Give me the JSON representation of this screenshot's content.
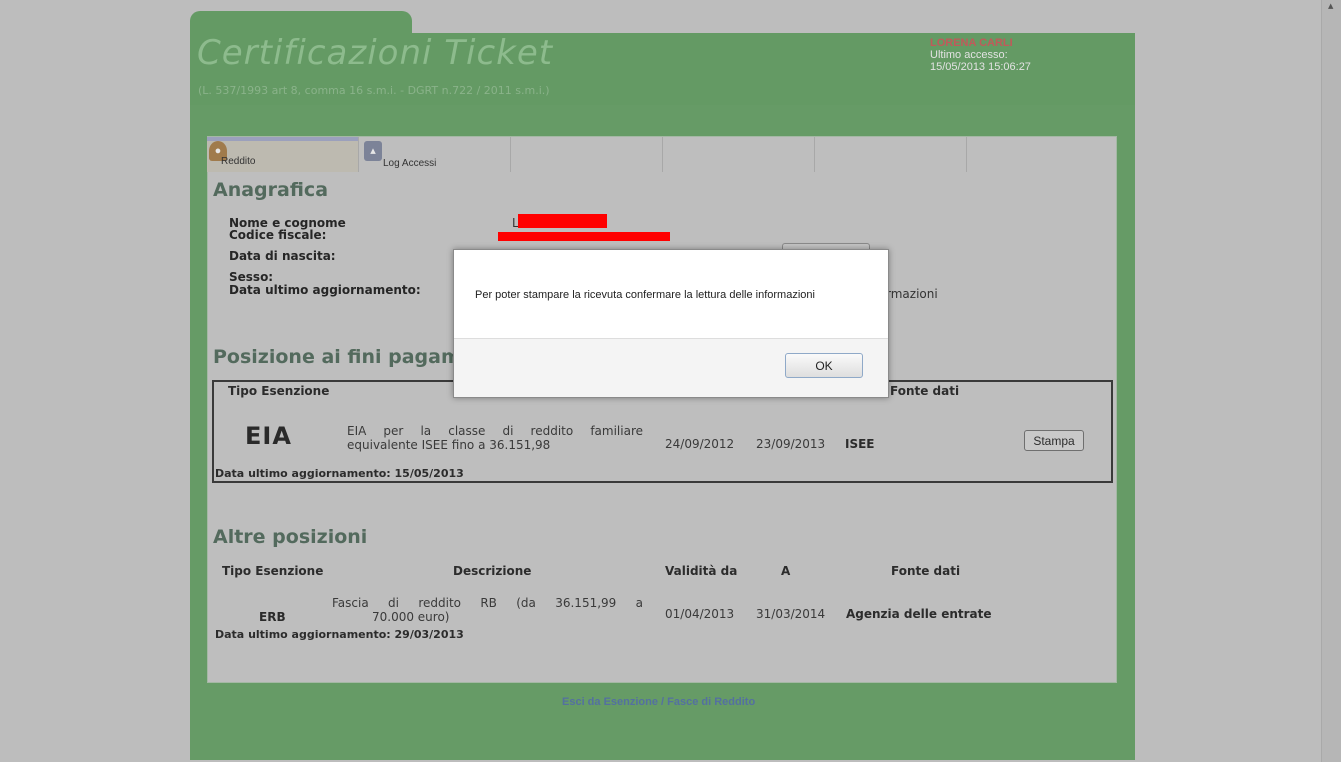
{
  "header": {
    "title": "Certificazioni Ticket",
    "subtitle": "(L. 537/1993 art 8, comma 16 s.m.i. - DGRT n.722 / 2011 s.m.i.)",
    "user_name": "LORENA CARLI",
    "last_access_label": "Ultimo accesso:",
    "last_access_value": "15/05/2013 15:06:27"
  },
  "tabs": [
    {
      "label": "Reddito",
      "icon": "user-icon"
    },
    {
      "label": "Log Accessi",
      "icon": "log-icon"
    }
  ],
  "anagrafica": {
    "title": "Anagrafica",
    "fields": [
      {
        "label": "Nome e cognome",
        "value": "L"
      },
      {
        "label": "Codice fiscale:"
      },
      {
        "label": "Data di nascita:"
      },
      {
        "label": "Sesso:"
      },
      {
        "label": "Data ultimo aggiornamento:",
        "value": "rmazioni"
      }
    ]
  },
  "posizione": {
    "title": "Posizione ai fini pagam",
    "col_tipo": "Tipo Esenzione",
    "col_fonte": "Fonte dati",
    "row": {
      "code": "EIA",
      "description_line1": "EIA per la classe di reddito familiare",
      "description_line2": "equivalente ISEE fino a 36.151,98",
      "from": "24/09/2012",
      "to": "23/09/2013",
      "source": "ISEE",
      "print_label": "Stampa"
    },
    "updated": "Data ultimo aggiornamento: 15/05/2013"
  },
  "altre": {
    "title": "Altre posizioni",
    "headers": {
      "tipo": "Tipo Esenzione",
      "descrizione": "Descrizione",
      "validita": "Validità da",
      "a": "A",
      "fonte": "Fonte dati"
    },
    "row": {
      "code": "ERB",
      "description_line1": "Fascia di reddito RB (da 36.151,99 a",
      "description_line2": "70.000 euro)",
      "from": "01/04/2013",
      "to": "31/03/2014",
      "source": "Agenzia delle entrate"
    },
    "updated": "Data ultimo aggiornamento: 29/03/2013"
  },
  "footer": {
    "link": "Esci da Esenzione / Fasce di Reddito"
  },
  "modal": {
    "message": "Per poter stampare la ricevuta confermare la lettura delle informazioni",
    "ok_label": "OK"
  },
  "colors": {
    "header_green": "#649a64",
    "panel_gray": "#bebebe",
    "user_red": "#c05a5a",
    "redaction_red": "#ff0000",
    "link_blue": "#5470a0"
  }
}
